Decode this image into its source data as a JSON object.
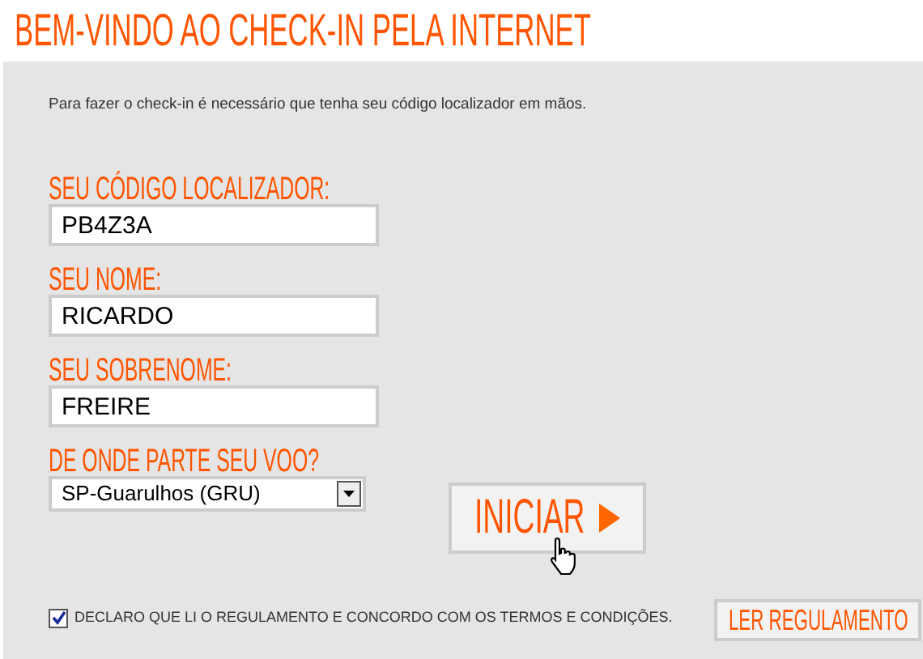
{
  "title": "BEM-VINDO AO CHECK-IN PELA INTERNET",
  "intro": "Para fazer o check-in é necessário que tenha seu código localizador em mãos.",
  "fields": [
    {
      "kind": "text",
      "label": "SEU CÓDIGO LOCALIZADOR:",
      "value": "PB4Z3A"
    },
    {
      "kind": "text",
      "label": "SEU NOME:",
      "value": "RICARDO"
    },
    {
      "kind": "text",
      "label": "SEU SOBRENOME:",
      "value": "FREIRE"
    },
    {
      "kind": "select",
      "label": "DE ONDE PARTE SEU VOO?",
      "value": "SP-Guarulhos (GRU)"
    }
  ],
  "start_button": "INICIAR",
  "agreement": {
    "label": "DECLARO QUE LI O REGULAMENTO E CONCORDO COM OS TERMOS E CONDIÇÕES.",
    "checked": true
  },
  "rules_button": "LER REGULAMENTO"
}
